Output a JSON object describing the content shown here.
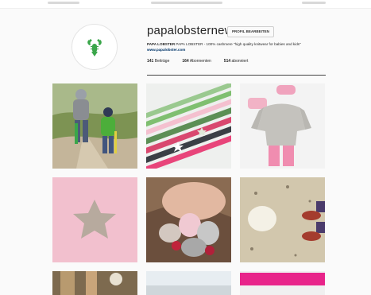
{
  "profile": {
    "username": "papalobsternews",
    "edit_button": "PROFIL BEARBEITEN",
    "bio_name": "PAPA LOBSTER",
    "bio_text": " PAPA LOBSTER - 100% cashmere \"high quality knitwear for babies and kids\" ",
    "bio_link": "www.papalobster.com",
    "stats": {
      "posts_count": "141",
      "posts_label": " Beiträge",
      "followers_count": "164",
      "followers_label": " Abonnenten",
      "following_count": "514",
      "following_label": " abonniert"
    },
    "logo_icon": "lobster-icon"
  },
  "colors": {
    "background": "#fafafa",
    "logo_green": "#3aa64a",
    "link": "#003569"
  },
  "posts": [
    {
      "label": "children walking on beach path"
    },
    {
      "label": "pink and green star ribbon stripes"
    },
    {
      "label": "grey sweater with pink pants flat lay"
    },
    {
      "label": "pink fabric with grey star"
    },
    {
      "label": "child holding knitted plush toys"
    },
    {
      "label": "beach sand with feet and stone"
    },
    {
      "label": "bottom row post 1"
    },
    {
      "label": "bottom row post 2"
    },
    {
      "label": "bottom row post 3"
    }
  ]
}
